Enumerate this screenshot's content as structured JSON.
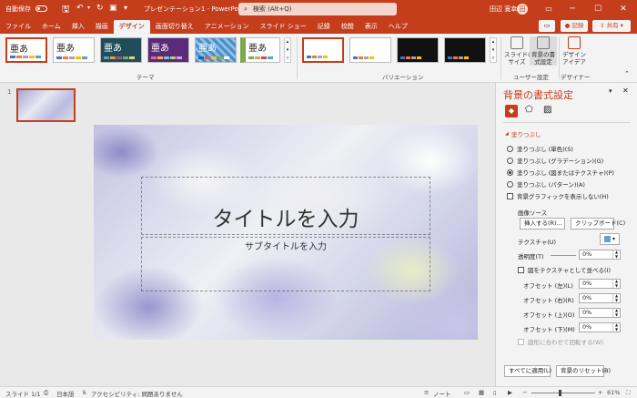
{
  "titlebar": {
    "autosave": "自動保存",
    "filename": "プレゼンテーション1",
    "app": "PowerPoint",
    "search": "検索 (Alt+Q)",
    "user": "田辺 寛幸",
    "user_initials": "田"
  },
  "tabs": [
    "ファイル",
    "ホーム",
    "挿入",
    "描画",
    "デザイン",
    "画面切り替え",
    "アニメーション",
    "スライド ショー",
    "記録",
    "校閲",
    "表示",
    "ヘルプ"
  ],
  "ribbon_right": {
    "record": "記録",
    "share": "共有"
  },
  "ribbon": {
    "theme_sample": "亜あ",
    "group_theme": "テーマ",
    "group_variation": "バリエーション",
    "group_user": "ユーザー設定",
    "group_designer": "デザイナー",
    "slide_size": "スライドの\nサイズ",
    "format_bg": "背景の書\n式設定",
    "design_ideas": "デザイン\nアイデア"
  },
  "slide_number": "1",
  "slide": {
    "title": "タイトルを入力",
    "subtitle": "サブタイトルを入力"
  },
  "pane": {
    "title": "背景の書式設定",
    "section": "塗りつぶし",
    "options": [
      "塗りつぶし (単色)(S)",
      "塗りつぶし (グラデーション)(G)",
      "塗りつぶし (図またはテクスチャ)(P)",
      "塗りつぶし (パターン)(A)"
    ],
    "hide_graphics": "背景グラフィックを表示しない(H)",
    "image_source": "画像ソース",
    "insert": "挿入する(R)...",
    "clipboard": "クリップボード(C)",
    "texture": "テクスチャ(U)",
    "transparency": "透明度(T)",
    "transparency_val": "0%",
    "tile": "図をテクスチャとして並べる(I)",
    "offsets": [
      {
        "label": "オフセット (左)(L)",
        "val": "0%"
      },
      {
        "label": "オフセット (右)(R)",
        "val": "0%"
      },
      {
        "label": "オフセット (上)(O)",
        "val": "0%"
      },
      {
        "label": "オフセット (下)(M)",
        "val": "0%"
      }
    ],
    "rotate": "図形に合わせて回転する(W)",
    "apply_all": "すべてに適用(L)",
    "reset": "背景のリセット(B)"
  },
  "status": {
    "slide": "スライド 1/1",
    "lang": "日本語",
    "access": "アクセシビリティ: 問題ありません",
    "notes": "ノート",
    "zoom": "61%"
  },
  "colors": {
    "accent": "#c43e1c"
  }
}
